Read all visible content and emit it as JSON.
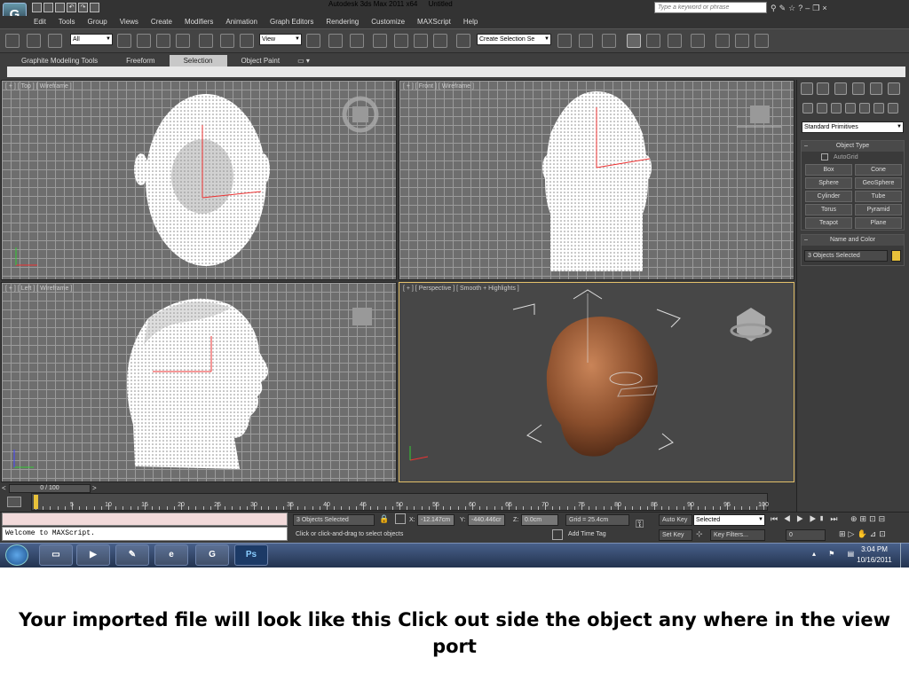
{
  "app": {
    "title": "Autodesk 3ds Max  2011 x64",
    "document": "Untitled",
    "search_placeholder": "Type a keyword or phrase",
    "logo_letter": "G"
  },
  "menu": [
    "Edit",
    "Tools",
    "Group",
    "Views",
    "Create",
    "Modifiers",
    "Animation",
    "Graph Editors",
    "Rendering",
    "Customize",
    "MAXScript",
    "Help"
  ],
  "toolbar": {
    "filter_value": "All",
    "coord_value": "View",
    "selection_set_value": "Create Selection Se"
  },
  "ribbon_tabs": [
    {
      "label": "Graphite Modeling Tools",
      "active": false
    },
    {
      "label": "Freeform",
      "active": false
    },
    {
      "label": "Selection",
      "active": true
    },
    {
      "label": "Object Paint",
      "active": false
    }
  ],
  "viewports": {
    "top": "[ + ] [ Top ] [ Wireframe ]",
    "front": "[ + ] [ Front ] [ Wireframe ]",
    "left": "[ + ] [ Left ] [ Wireframe ]",
    "perspective": "[ + ] [ Perspective ] [ Smooth + Highlights ]"
  },
  "command_panel": {
    "category": "Standard Primitives",
    "object_type_title": "Object Type",
    "autogrid_label": "AutoGrid",
    "buttons": [
      "Box",
      "Cone",
      "Sphere",
      "GeoSphere",
      "Cylinder",
      "Tube",
      "Torus",
      "Pyramid",
      "Teapot",
      "Plane"
    ],
    "name_color_title": "Name and Color",
    "name_value": "3 Objects Selected",
    "object_color": "#e8c13a"
  },
  "timeline": {
    "slider": "0 / 100",
    "ticks": [
      "5",
      "10",
      "15",
      "20",
      "25",
      "30",
      "35",
      "40",
      "45",
      "50",
      "55",
      "60",
      "65",
      "70",
      "75",
      "80",
      "85",
      "90",
      "95",
      "100"
    ]
  },
  "status": {
    "listener": "Welcome to MAXScript.",
    "selection": "3 Objects Selected",
    "prompt": "Click or click-and-drag to select objects",
    "x_label": "X:",
    "x_value": "-12.147cm",
    "y_label": "Y:",
    "y_value": "-440.446cr",
    "z_label": "Z:",
    "z_value": "0.0cm",
    "grid": "Grid = 25.4cm",
    "add_time_tag": "Add Time Tag",
    "auto_key": "Auto Key",
    "set_key": "Set Key",
    "key_mode": "Selected",
    "key_filters": "Key Filters...",
    "frame": "0"
  },
  "taskbar": {
    "apps": [
      "start-orb",
      "explorer-icon",
      "media-player-icon",
      "paint-icon",
      "ie-icon",
      "3dsmax-icon",
      "photoshop-icon"
    ],
    "ps_label": "Ps",
    "max_label": "G",
    "time": "3:04 PM",
    "date": "10/16/2011"
  },
  "caption": "Your imported file will look like this Click out side the object any where in the view port"
}
